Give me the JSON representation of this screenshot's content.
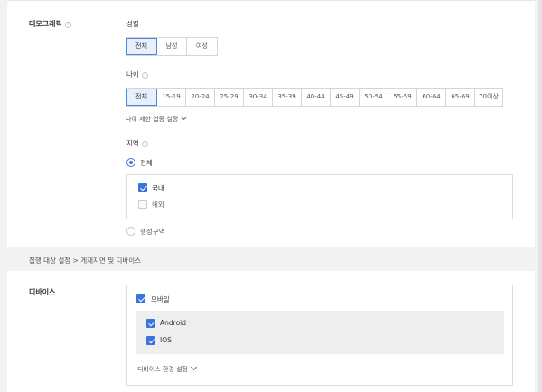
{
  "demographic": {
    "label": "데모그래픽",
    "help": "?",
    "gender": {
      "label": "성별",
      "options": [
        "전체",
        "남성",
        "여성"
      ],
      "selected": "전체"
    },
    "age": {
      "label": "나이",
      "help": "?",
      "options": [
        "전체",
        "15-19",
        "20-24",
        "25-29",
        "30-34",
        "35-39",
        "40-44",
        "45-49",
        "50-54",
        "55-59",
        "60-64",
        "65-69",
        "70이상"
      ],
      "selected": "전체",
      "restrict_link": "나이 제한 업종 설정"
    },
    "region": {
      "label": "지역",
      "help": "?",
      "radio_all": "전체",
      "domestic": "국내",
      "overseas": "해외",
      "radio_admin": "행정구역"
    }
  },
  "section_header": "집행 대상 설정 > 게재지면 및 디바이스",
  "device": {
    "label": "디바이스",
    "mobile": "모바일",
    "android": "Android",
    "ios": "IOS",
    "env_link": "디바이스 환경 설정"
  },
  "colors": {
    "accent": "#3a72e0",
    "selected_bg": "#e8f0fd"
  }
}
